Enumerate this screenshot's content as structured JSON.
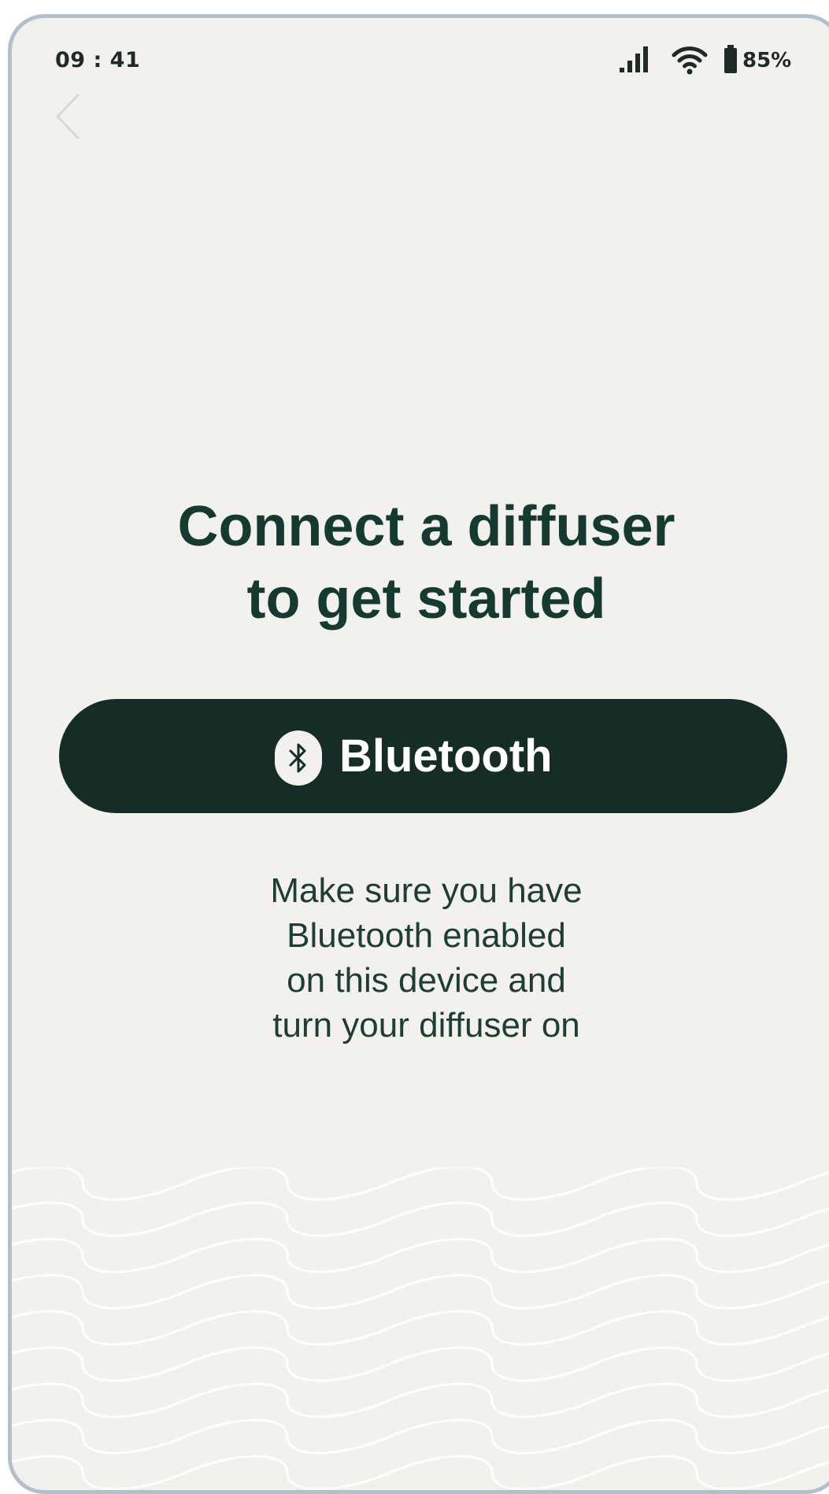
{
  "status_bar": {
    "time": "09 : 41",
    "signal_icon": "cellular-signal-icon",
    "wifi_icon": "wifi-icon",
    "battery_icon": "battery-icon",
    "battery_percent": "85%"
  },
  "nav": {
    "back_icon": "chevron-left-icon"
  },
  "main": {
    "title_line_1": "Connect a diffuser",
    "title_line_2": "to get started",
    "bluetooth_button": {
      "icon": "bluetooth-icon",
      "label": "Bluetooth"
    },
    "helper_lines": [
      "Make sure you have",
      "Bluetooth enabled",
      "on this device and",
      "turn your diffuser on"
    ]
  },
  "colors": {
    "background": "#f2f1ee",
    "primary_dark": "#162d27",
    "title_text": "#173a30",
    "body_text": "#1f3d35",
    "device_border": "#b4bfcc"
  }
}
